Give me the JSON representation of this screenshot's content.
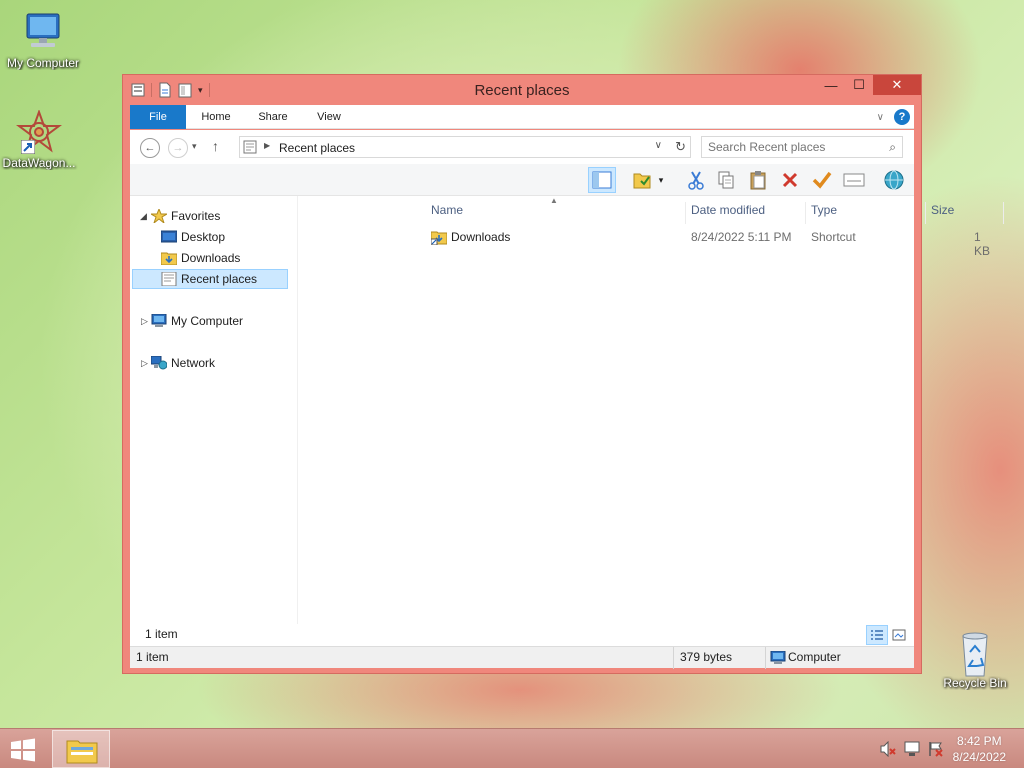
{
  "desktop": {
    "icons": [
      {
        "label": "My Computer"
      },
      {
        "label": "DataWagon..."
      },
      {
        "label": "Recycle Bin"
      }
    ]
  },
  "window": {
    "title": "Recent places",
    "ribbon_tabs": [
      "File",
      "Home",
      "Share",
      "View"
    ],
    "address": {
      "path": "Recent places"
    },
    "search": {
      "placeholder": "Search Recent places"
    },
    "nav": {
      "favorites": "Favorites",
      "desktop": "Desktop",
      "downloads": "Downloads",
      "recent_places": "Recent places",
      "my_computer": "My Computer",
      "network": "Network"
    },
    "columns": [
      "Name",
      "Date modified",
      "Type",
      "Size"
    ],
    "files": [
      {
        "name": "Downloads",
        "date_modified": "8/24/2022 5:11 PM",
        "type": "Shortcut",
        "size": "1 KB"
      }
    ],
    "status": {
      "item_count": "1 item"
    },
    "details": {
      "items": "1 item",
      "bytes": "379 bytes",
      "location": "Computer"
    }
  },
  "taskbar": {
    "time": "8:42 PM",
    "date": "8/24/2022"
  },
  "colors": {
    "accent": "#1979ca",
    "window_frame": "#f0877c",
    "close_button": "#c9463c",
    "selection": "#cce8ff",
    "taskbar": "#d9a39a"
  }
}
